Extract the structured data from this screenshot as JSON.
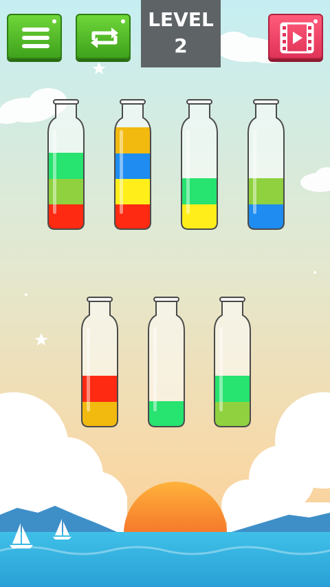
{
  "header": {
    "level_title": "LEVEL",
    "level_number": "2",
    "menu_icon": "menu-icon",
    "restart_icon": "restart-icon",
    "video_icon": "video-icon"
  },
  "colors": {
    "red": "#ff2a12",
    "lime": "#8fd13f",
    "green": "#27e36f",
    "yellow": "#ffee1a",
    "orange": "#f2b90f",
    "blue": "#1e8cf0"
  },
  "bottles": [
    {
      "name": "bottle-1",
      "layers": [
        "red",
        "lime",
        "green"
      ]
    },
    {
      "name": "bottle-2",
      "layers": [
        "red",
        "yellow",
        "blue",
        "orange"
      ]
    },
    {
      "name": "bottle-3",
      "layers": [
        "yellow",
        "green"
      ]
    },
    {
      "name": "bottle-4",
      "layers": [
        "blue",
        "lime"
      ]
    },
    {
      "name": "bottle-5",
      "layers": [
        "orange",
        "red"
      ]
    },
    {
      "name": "bottle-6",
      "layers": [
        "green"
      ]
    },
    {
      "name": "bottle-7",
      "layers": [
        "lime",
        "green"
      ]
    }
  ]
}
